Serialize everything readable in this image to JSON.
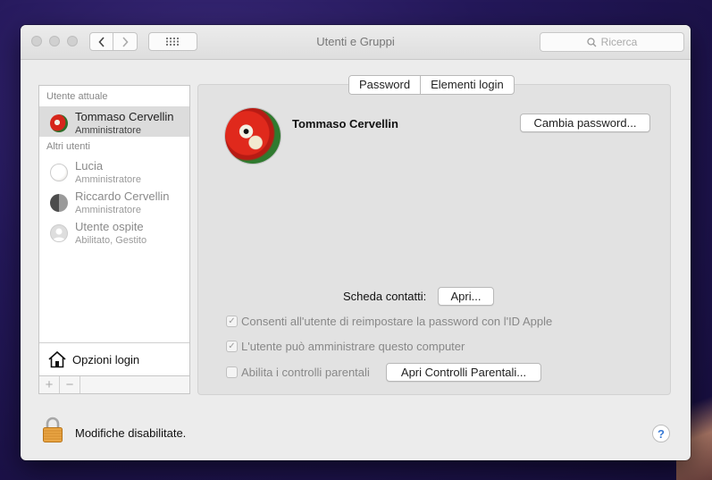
{
  "window": {
    "title": "Utenti e Gruppi"
  },
  "search": {
    "placeholder": "Ricerca"
  },
  "sidebar": {
    "current_header": "Utente attuale",
    "others_header": "Altri utenti",
    "users": [
      {
        "name": "Tommaso Cervellin",
        "role": "Amministratore"
      },
      {
        "name": "Lucia",
        "role": "Amministratore"
      },
      {
        "name": "Riccardo Cervellin",
        "role": "Amministratore"
      },
      {
        "name": "Utente ospite",
        "role": "Abilitato, Gestito"
      }
    ],
    "login_options": "Opzioni login",
    "add": "+",
    "remove": "−"
  },
  "tabs": [
    "Password",
    "Elementi login"
  ],
  "profile": {
    "name": "Tommaso Cervellin",
    "change_password": "Cambia password..."
  },
  "contacts": {
    "label": "Scheda contatti:",
    "open": "Apri..."
  },
  "options": [
    {
      "label": "Consenti all'utente di reimpostare la password con l'ID Apple",
      "checked": true
    },
    {
      "label": "L'utente può amministrare questo computer",
      "checked": true
    },
    {
      "label": "Abilita i controlli parentali",
      "checked": false
    }
  ],
  "parental_button": "Apri Controlli Parentali...",
  "lock": {
    "status": "Modifiche disabilitate."
  },
  "help": "?"
}
